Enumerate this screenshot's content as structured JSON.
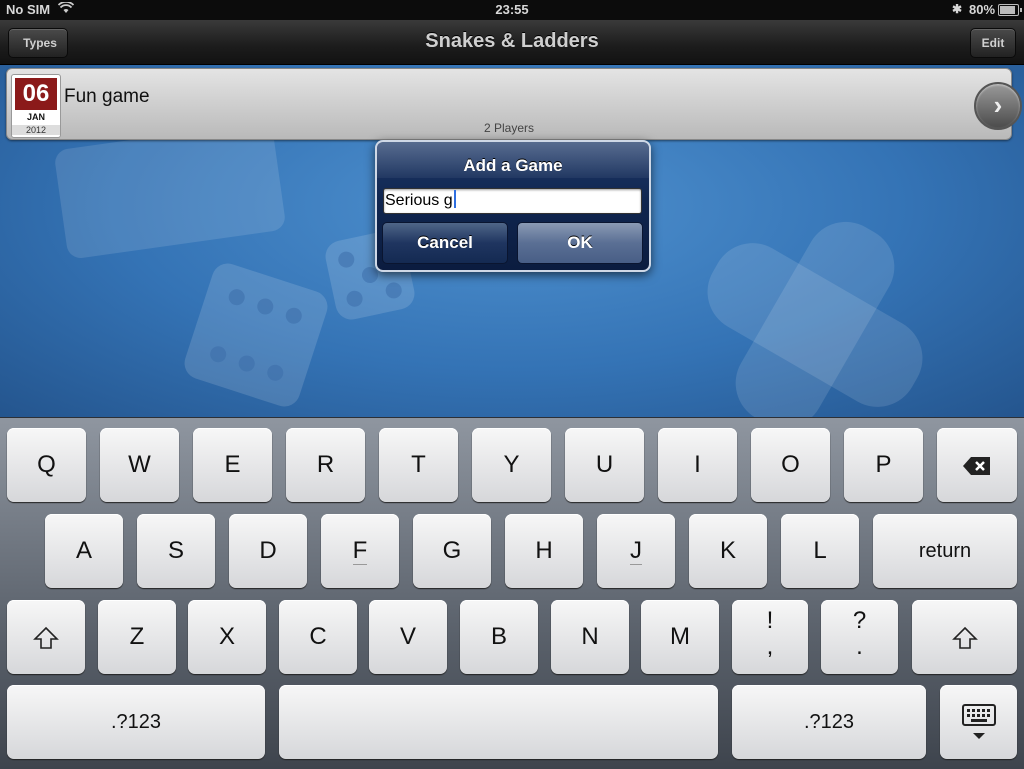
{
  "status_bar": {
    "carrier": "No SIM",
    "wifi_icon": "wifi-icon",
    "time": "23:55",
    "bluetooth_icon": "bluetooth-icon",
    "battery_percent": "80%",
    "battery_level": 0.8
  },
  "nav": {
    "back_label": "Types",
    "title": "Snakes & Ladders",
    "edit_label": "Edit"
  },
  "games": [
    {
      "day": "06",
      "month": "JAN",
      "year": "2012",
      "name": "Fun game",
      "players": "2 Players"
    }
  ],
  "alert": {
    "title": "Add a Game",
    "input_value": "Serious g",
    "cancel_label": "Cancel",
    "ok_label": "OK"
  },
  "keyboard": {
    "row1": [
      "Q",
      "W",
      "E",
      "R",
      "T",
      "Y",
      "U",
      "I",
      "O",
      "P"
    ],
    "backspace_icon": "backspace-icon",
    "row2": [
      "A",
      "S",
      "D",
      "F",
      "G",
      "H",
      "J",
      "K",
      "L"
    ],
    "return_label": "return",
    "shift_icon": "shift-icon",
    "row3": [
      "Z",
      "X",
      "C",
      "V",
      "B",
      "N",
      "M"
    ],
    "excl_top": "!",
    "excl_bottom": ",",
    "quest_top": "?",
    "quest_bottom": ".",
    "numbers_label": ".?123",
    "hide_keyboard_icon": "hide-keyboard-icon"
  },
  "colors": {
    "calendar_red": "#8b1a1a",
    "alert_blue": "#102650",
    "background_blue": "#3473b5"
  }
}
